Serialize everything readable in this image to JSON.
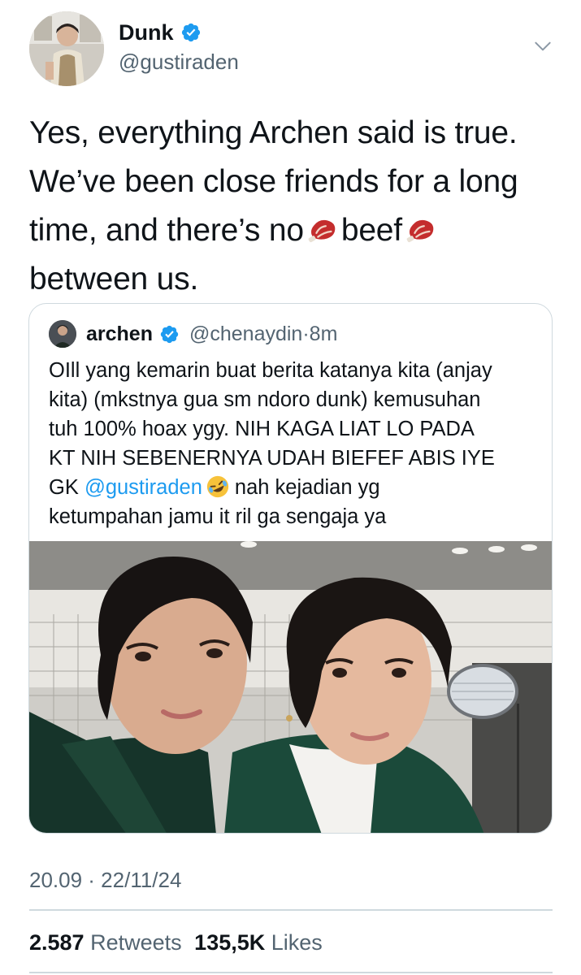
{
  "author": {
    "display_name": "Dunk",
    "handle": "@gustiraden"
  },
  "tweet": {
    "lines": [
      "Yes, everything Archen said is true.",
      "We’ve been close friends for a long",
      "time, and there’s no",
      "beef",
      "between us."
    ],
    "emoji_icons": [
      "meat-icon",
      "meat-icon"
    ]
  },
  "quoted": {
    "display_name": "archen",
    "handle": "@chenaydin",
    "separator": "·",
    "age": "8m",
    "lines": [
      "OIll yang kemarin buat berita katanya kita (anjay",
      "kita) (mkstnya gua sm ndoro dunk) kemusuhan",
      "tuh 100% hoax ygy. NIH KAGA LIAT LO PADA",
      "KT NIH SEBENERNYA UDAH BIEFEF ABIS IYE",
      "GK",
      "@gustiraden",
      "nah kejadian yg",
      "ketumpahan jamu it ril ga sengaja ya"
    ],
    "emoji_icon": "rofl-emoji-icon"
  },
  "timestamp": "20.09 · 22/11/24",
  "stats": {
    "retweets_count": "2.587",
    "retweets_label": "Retweets",
    "likes_count": "135,5K",
    "likes_label": "Likes"
  },
  "colors": {
    "text": "#0f1419",
    "secondary": "#536471",
    "link": "#1d9bf0",
    "border": "#cfd9de"
  }
}
